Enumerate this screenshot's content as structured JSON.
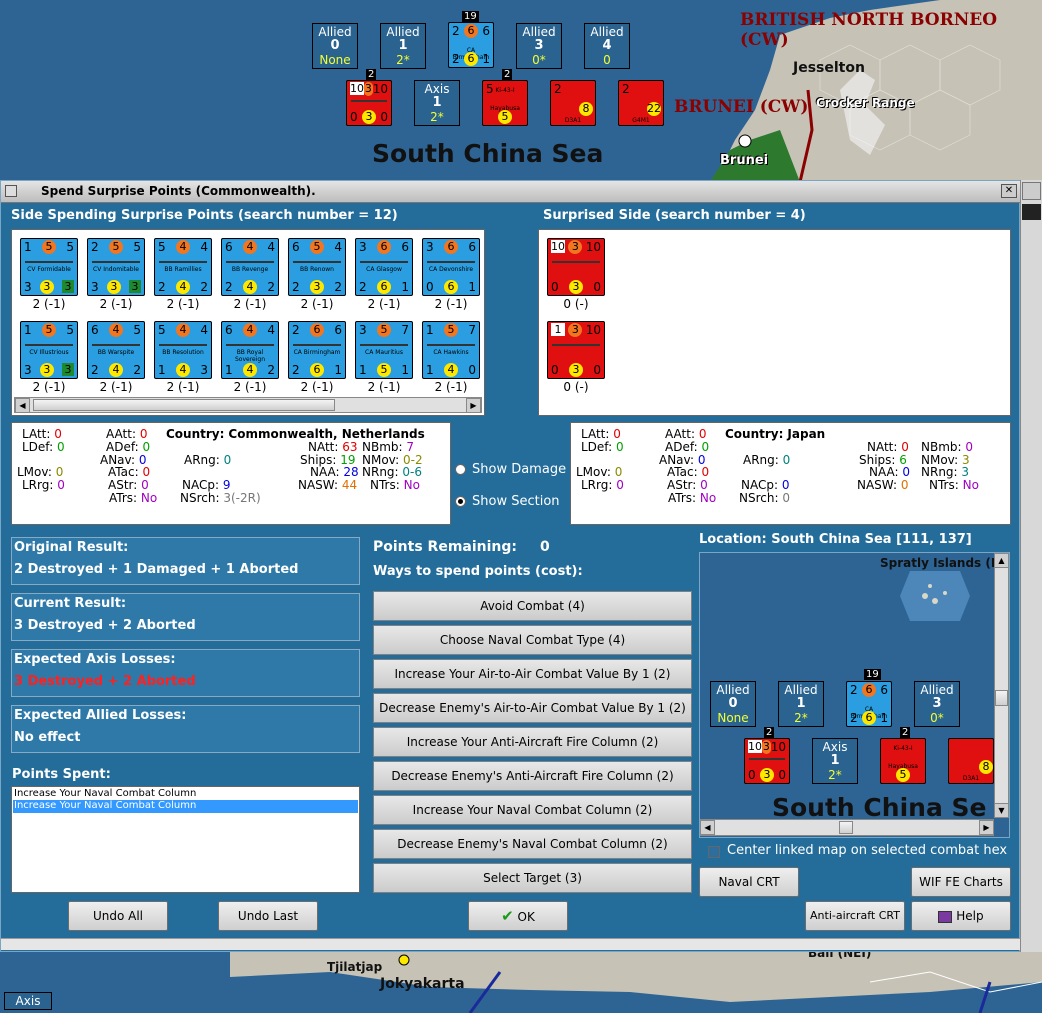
{
  "map_top": {
    "region_label": "BRITISH NORTH BORNEO (CW)",
    "brunei_label": "BRUNEI (CW)",
    "sea_label": "South China Sea",
    "cities": [
      "Jesselton",
      "Crocker Range",
      "Brunei"
    ],
    "boxes": [
      {
        "side": "Allied",
        "num": "0",
        "sub": "None"
      },
      {
        "side": "Allied",
        "num": "1",
        "sub": "2*"
      },
      {
        "side": "Allied",
        "num": "3",
        "sub": "0*"
      },
      {
        "side": "Allied",
        "num": "4",
        "sub": "0"
      },
      {
        "side": "Axis",
        "num": "1",
        "sub": "2*"
      }
    ],
    "stack_counts": [
      "19",
      "2",
      "2"
    ]
  },
  "dialog": {
    "title": "Spend Surprise Points (Commonwealth).",
    "left_header": "Side Spending Surprise Points (search number = 12)",
    "right_header": "Surprised Side (search number = 4)",
    "allied_units": [
      {
        "name": "CV Formidable",
        "tl": "1",
        "tm": "5",
        "tr": "5",
        "bl": "3",
        "bm": "3",
        "br": "3",
        "cap": "2 (-1)"
      },
      {
        "name": "CV Indomitable",
        "tl": "2",
        "tm": "5",
        "tr": "5",
        "bl": "3",
        "bm": "3",
        "br": "3",
        "cap": "2 (-1)"
      },
      {
        "name": "BB Ramillies",
        "tl": "5",
        "tm": "4",
        "tr": "4",
        "bl": "2",
        "bm": "4",
        "br": "2",
        "cap": "2 (-1)"
      },
      {
        "name": "BB Revenge",
        "tl": "6",
        "tm": "4",
        "tr": "4",
        "bl": "2",
        "bm": "4",
        "br": "2",
        "cap": "2 (-1)"
      },
      {
        "name": "BB Renown",
        "tl": "6",
        "tm": "5",
        "tr": "4",
        "bl": "2",
        "bm": "3",
        "br": "2",
        "cap": "2 (-1)"
      },
      {
        "name": "CA Glasgow",
        "tl": "3",
        "tm": "6",
        "tr": "6",
        "bl": "2",
        "bm": "6",
        "br": "1",
        "cap": "2 (-1)"
      },
      {
        "name": "CA Devonshire",
        "tl": "3",
        "tm": "6",
        "tr": "6",
        "bl": "0",
        "bm": "6",
        "br": "1",
        "cap": "2 (-1)"
      },
      {
        "name": "CV Illustrious",
        "tl": "1",
        "tm": "5",
        "tr": "5",
        "bl": "3",
        "bm": "3",
        "br": "3",
        "cap": "2 (-1)"
      },
      {
        "name": "BB Warspite",
        "tl": "6",
        "tm": "4",
        "tr": "5",
        "bl": "2",
        "bm": "4",
        "br": "2",
        "cap": "2 (-1)"
      },
      {
        "name": "BB Resolution",
        "tl": "5",
        "tm": "4",
        "tr": "4",
        "bl": "1",
        "bm": "4",
        "br": "3",
        "cap": "2 (-1)"
      },
      {
        "name": "BB Royal Sovereign",
        "tl": "6",
        "tm": "4",
        "tr": "4",
        "bl": "1",
        "bm": "4",
        "br": "2",
        "cap": "2 (-1)"
      },
      {
        "name": "CA Birmingham",
        "tl": "2",
        "tm": "6",
        "tr": "6",
        "bl": "2",
        "bm": "6",
        "br": "1",
        "cap": "2 (-1)"
      },
      {
        "name": "CA Mauritius",
        "tl": "3",
        "tm": "5",
        "tr": "7",
        "bl": "1",
        "bm": "5",
        "br": "1",
        "cap": "2 (-1)"
      },
      {
        "name": "CA Hawkins",
        "tl": "1",
        "tm": "5",
        "tr": "7",
        "bl": "1",
        "bm": "4",
        "br": "0",
        "cap": "2 (-1)"
      }
    ],
    "axis_units": [
      {
        "tl": "10",
        "tm": "3",
        "tr": "10",
        "bl": "0",
        "bm": "3",
        "br": "0",
        "cap": "0 (-)"
      },
      {
        "tl": "1",
        "tm": "3",
        "tr": "10",
        "bl": "0",
        "bm": "3",
        "br": "0",
        "cap": "0 (-)"
      }
    ],
    "left_stats": {
      "LAtt": "0",
      "LDef": "0",
      "LMov": "0",
      "LRrg": "0",
      "AAtt": "0",
      "ADef": "0",
      "ANav": "0",
      "ATac": "0",
      "AStr": "0",
      "ATrs": "No",
      "ARng": "0",
      "NACp": "9",
      "NSrch": "3(-2R)",
      "country_label": "Country:",
      "country": "Commonwealth, Netherlands",
      "NAtt": "63",
      "Ships": "19",
      "NAA": "28",
      "NASW": "44",
      "NBmb": "7",
      "NMov": "0-2",
      "NRng": "0-6",
      "NTrs": "No"
    },
    "right_stats": {
      "LAtt": "0",
      "LDef": "0",
      "LMov": "0",
      "LRrg": "0",
      "AAtt": "0",
      "ADef": "0",
      "ANav": "0",
      "ATac": "0",
      "AStr": "0",
      "ATrs": "No",
      "ARng": "0",
      "NACp": "0",
      "NSrch": "0",
      "country_label": "Country:",
      "country": "Japan",
      "NAtt": "0",
      "Ships": "6",
      "NAA": "0",
      "NASW": "0",
      "NBmb": "0",
      "NMov": "3",
      "NRng": "3",
      "NTrs": "No"
    },
    "show_damage": "Show Damage",
    "show_section": "Show Section",
    "original_result_label": "Original Result:",
    "original_result": "2 Destroyed + 1 Damaged + 1 Aborted",
    "current_result_label": "Current Result:",
    "current_result": "3 Destroyed + 2 Aborted",
    "axis_losses_label": "Expected Axis Losses:",
    "axis_losses": "3 Destroyed + 2 Aborted",
    "allied_losses_label": "Expected Allied Losses:",
    "allied_losses": "No effect",
    "points_spent_label": "Points Spent:",
    "points_spent": [
      "Increase Your Naval Combat Column",
      "Increase Your Naval Combat Column"
    ],
    "points_remaining_label": "Points Remaining:",
    "points_remaining": "0",
    "ways_label": "Ways to spend points (cost):",
    "ways": [
      "Avoid Combat (4)",
      "Choose Naval Combat Type (4)",
      "Increase Your Air-to-Air Combat Value By 1 (2)",
      "Decrease Enemy's Air-to-Air Combat Value By 1 (2)",
      "Increase Your Anti-Aircraft Fire Column (2)",
      "Decrease Enemy's Anti-Aircraft Fire Column (2)",
      "Increase Your Naval Combat Column (2)",
      "Decrease Enemy's Naval Combat Column (2)",
      "Select Target (3)"
    ],
    "location_label": "Location: South China Sea [111, 137]",
    "minimap": {
      "island": "Spratly Islands (B",
      "sea": "South China Se",
      "boxes": [
        {
          "side": "Allied",
          "num": "0",
          "sub": "None"
        },
        {
          "side": "Allied",
          "num": "1",
          "sub": "2*"
        },
        {
          "side": "Allied",
          "num": "3",
          "sub": "0*"
        },
        {
          "side": "Axis",
          "num": "1",
          "sub": "2*"
        }
      ],
      "stack_counts": [
        "19",
        "2",
        "2"
      ]
    },
    "center_linked": "Center linked map on selected combat hex",
    "buttons": {
      "naval_crt": "Naval CRT",
      "wif_fe_charts": "WIF FE Charts",
      "undo_all": "Undo All",
      "undo_last": "Undo Last",
      "ok": "OK",
      "aa_crt": "Anti-aircraft CRT",
      "help": "Help"
    }
  },
  "map_bottom": {
    "cities": [
      "Tjilatjap",
      "Jokyakarta",
      "Bali (NEI)"
    ],
    "axis_tab": "Axis"
  },
  "counter_labels": {
    "top_birmingham": "CA Birmingham",
    "ki43": "Ki-43-I",
    "hayabusa": "Hayabusa",
    "d3a1": "D3A1",
    "g4m1": "G4M1"
  }
}
